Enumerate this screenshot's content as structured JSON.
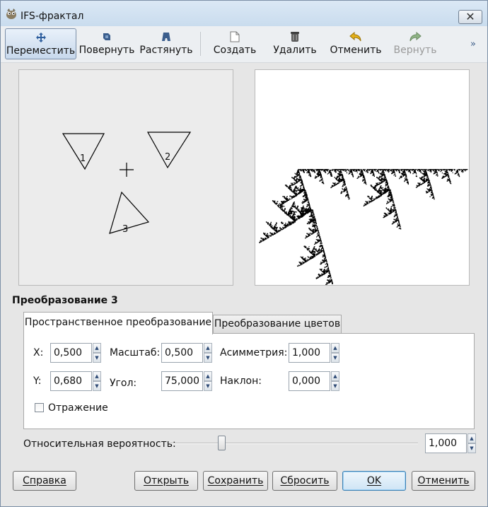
{
  "window": {
    "title": "IFS-фрактал",
    "close_glyph": "✕"
  },
  "toolbar": {
    "items": [
      {
        "label": "Переместить",
        "icon": "move-icon",
        "active": true
      },
      {
        "label": "Повернуть",
        "icon": "rotate-icon"
      },
      {
        "label": "Растянуть",
        "icon": "stretch-icon"
      },
      {
        "label": "Создать",
        "icon": "new-document-icon"
      },
      {
        "label": "Удалить",
        "icon": "trash-icon"
      },
      {
        "label": "Отменить",
        "icon": "undo-icon"
      },
      {
        "label": "Вернуть",
        "icon": "redo-icon",
        "disabled": true
      }
    ],
    "more_glyph": "»"
  },
  "design": {
    "triangle_labels": [
      "1",
      "2",
      "3"
    ]
  },
  "transform": {
    "title": "Преобразование 3",
    "tabs": [
      "Пространственное преобразование",
      "Преобразование цветов"
    ],
    "fields": {
      "x": {
        "label": "X:",
        "value": "0,500"
      },
      "y": {
        "label": "Y:",
        "value": "0,680"
      },
      "scale": {
        "label": "Масштаб:",
        "value": "0,500"
      },
      "angle": {
        "label": "Угол:",
        "value": "75,000"
      },
      "asym": {
        "label": "Асимметрия:",
        "value": "1,000"
      },
      "shear": {
        "label": "Наклон:",
        "value": "0,000"
      }
    },
    "flip_label": "Отражение",
    "flip_checked": false
  },
  "probability": {
    "label": "Относительная вероятность:",
    "value": "1,000",
    "slider_fraction": 0.2
  },
  "buttons": {
    "help": "Справка",
    "open": "Открыть",
    "save": "Сохранить",
    "reset": "Сбросить",
    "ok": "OK",
    "cancel": "Отменить"
  },
  "colors": {
    "accent": "#3c7fb1",
    "title_bar": "#c9dcee",
    "panel": "#e6e6e6"
  }
}
